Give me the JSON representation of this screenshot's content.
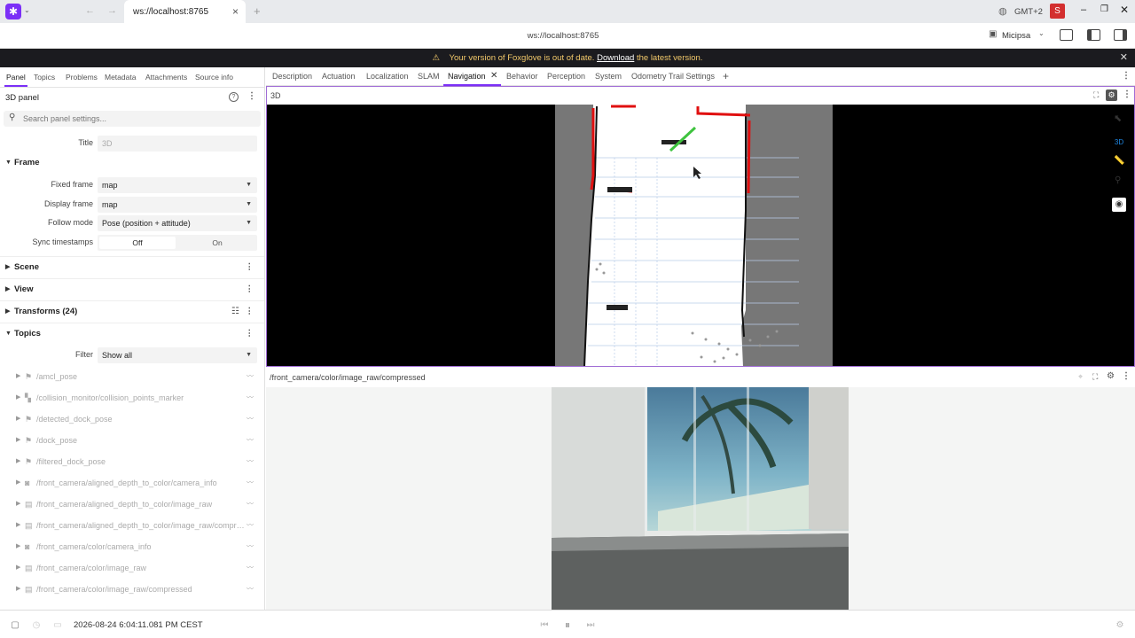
{
  "browser": {
    "tab_title": "ws://localhost:8765",
    "address": "ws://localhost:8765",
    "timezone": "GMT+2",
    "avatar": "S",
    "workspace": "Micipsa"
  },
  "banner": {
    "text_before": "Your version of Foxglove is out of date.",
    "link": "Download",
    "text_after": "the latest version."
  },
  "sidebar": {
    "tabs": [
      "Panel",
      "Topics",
      "Problems",
      "Metadata",
      "Attachments",
      "Source info"
    ],
    "panel_title": "3D panel",
    "search_placeholder": "Search panel settings...",
    "title_label": "Title",
    "title_placeholder": "3D",
    "frame_section": "Frame",
    "fixed_frame_label": "Fixed frame",
    "fixed_frame_value": "map",
    "display_frame_label": "Display frame",
    "display_frame_value": "map",
    "follow_mode_label": "Follow mode",
    "follow_mode_value": "Pose (position + attitude)",
    "sync_label": "Sync timestamps",
    "sync_off": "Off",
    "sync_on": "On",
    "scene_section": "Scene",
    "view_section": "View",
    "transforms_section": "Transforms (24)",
    "topics_section": "Topics",
    "filter_label": "Filter",
    "filter_value": "Show all",
    "topics": [
      {
        "name": "/amcl_pose",
        "icon": "flag-icon"
      },
      {
        "name": "/collision_monitor/collision_points_marker",
        "icon": "shapes-icon"
      },
      {
        "name": "/detected_dock_pose",
        "icon": "flag-icon"
      },
      {
        "name": "/dock_pose",
        "icon": "flag-icon"
      },
      {
        "name": "/filtered_dock_pose",
        "icon": "flag-icon"
      },
      {
        "name": "/front_camera/aligned_depth_to_color/camera_info",
        "icon": "camera-icon"
      },
      {
        "name": "/front_camera/aligned_depth_to_color/image_raw",
        "icon": "image-icon"
      },
      {
        "name": "/front_camera/aligned_depth_to_color/image_raw/compre...",
        "icon": "image-icon"
      },
      {
        "name": "/front_camera/color/camera_info",
        "icon": "camera-icon"
      },
      {
        "name": "/front_camera/color/image_raw",
        "icon": "image-icon"
      },
      {
        "name": "/front_camera/color/image_raw/compressed",
        "icon": "image-icon"
      }
    ]
  },
  "layout_tabs": [
    "Description",
    "Actuation",
    "Localization",
    "SLAM",
    "Navigation",
    "Behavior",
    "Perception",
    "System",
    "Odometry Trail Settings"
  ],
  "active_layout_tab": "Navigation",
  "panel3d": {
    "title": "3D",
    "mode_label": "3D"
  },
  "camera_panel": {
    "title": "/front_camera/color/image_raw/compressed"
  },
  "status": {
    "timestamp": "2026-08-24 6:04:11.081 PM CEST"
  },
  "colors": {
    "accent": "#a06cd5",
    "banner_bg": "#1b1b1f",
    "banner_text": "#f1c86a",
    "foxglove_logo": "#7b2ff7",
    "avatar_bg": "#d32f2f"
  }
}
